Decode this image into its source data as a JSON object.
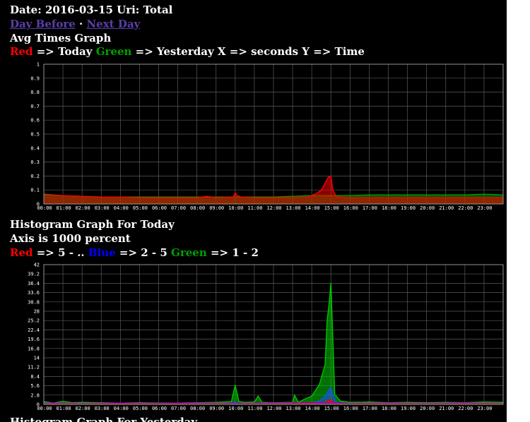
{
  "header": {
    "date_line": "Date: 2016-03-15 Uri: Total",
    "nav": {
      "prev": "Day Before",
      "sep": " · ",
      "next": "Next Day"
    }
  },
  "avg_section": {
    "title": "Avg Times Graph",
    "legend": [
      {
        "text": "Red",
        "color": "#ff0000"
      },
      {
        "text": " => Today ",
        "color": "#ffffff"
      },
      {
        "text": "Green",
        "color": "#00a000"
      },
      {
        "text": " => Yesterday X => seconds Y => Time",
        "color": "#ffffff"
      }
    ]
  },
  "hist_section": {
    "title": "Histogram Graph For Today",
    "subtitle": "Axis is 1000 percent",
    "legend": [
      {
        "text": "Red",
        "color": "#ff0000"
      },
      {
        "text": " => 5 - .. ",
        "color": "#ffffff"
      },
      {
        "text": "Blue",
        "color": "#0000ff"
      },
      {
        "text": " => 2 - 5 ",
        "color": "#ffffff"
      },
      {
        "text": "Green",
        "color": "#00a000"
      },
      {
        "text": " => 1 - 2",
        "color": "#ffffff"
      }
    ]
  },
  "footer": {
    "partial_title": "Histogram Graph For Yesterday"
  },
  "chart_data": [
    {
      "type": "area",
      "x_unit": "hour",
      "xlim": [
        0,
        24
      ],
      "ylim": [
        0,
        1
      ],
      "yticks": [
        "0",
        "0.1",
        "0.2",
        "0.3",
        "0.4",
        "0.5",
        "0.6",
        "0.7",
        "0.8",
        "0.9",
        "1"
      ],
      "xticks": [
        "00:00",
        "01:00",
        "02:00",
        "03:00",
        "04:00",
        "05:00",
        "06:00",
        "07:00",
        "08:00",
        "09:00",
        "10:00",
        "11:00",
        "12:00",
        "13:00",
        "14:00",
        "15:00",
        "16:00",
        "17:00",
        "18:00",
        "19:00",
        "20:00",
        "21:00",
        "22:00",
        "23:00"
      ],
      "grid": true,
      "series": [
        {
          "color": "#00a000",
          "fill": true,
          "x": [
            0,
            1,
            2,
            3,
            4,
            5,
            6,
            7,
            8,
            9,
            10,
            11,
            12,
            13,
            14,
            15,
            16,
            17,
            18,
            19,
            20,
            21,
            22,
            23,
            24
          ],
          "y": [
            0.07,
            0.06,
            0.055,
            0.05,
            0.05,
            0.05,
            0.05,
            0.05,
            0.05,
            0.05,
            0.05,
            0.05,
            0.05,
            0.055,
            0.06,
            0.06,
            0.06,
            0.065,
            0.065,
            0.065,
            0.065,
            0.065,
            0.065,
            0.07,
            0.065
          ]
        },
        {
          "color": "#ff0000",
          "fill": true,
          "x": [
            0,
            1,
            2,
            3,
            4,
            5,
            6,
            7,
            8,
            8.5,
            9,
            9.9,
            10,
            10.1,
            10.3,
            11,
            12,
            13,
            13.8,
            14,
            14.3,
            14.5,
            14.7,
            14.85,
            15,
            15.1,
            15.3,
            16,
            17,
            18,
            19,
            20,
            21,
            22,
            23,
            24
          ],
          "y": [
            0.065,
            0.06,
            0.055,
            0.05,
            0.05,
            0.045,
            0.045,
            0.045,
            0.045,
            0.055,
            0.045,
            0.05,
            0.08,
            0.06,
            0.05,
            0.045,
            0.045,
            0.045,
            0.05,
            0.06,
            0.08,
            0.1,
            0.15,
            0.19,
            0.2,
            0.1,
            0.05,
            0.045,
            0.045,
            0.045,
            0.045,
            0.045,
            0.045,
            0.045,
            0.045,
            0.045
          ]
        }
      ]
    },
    {
      "type": "area",
      "x_unit": "hour",
      "xlim": [
        0,
        24
      ],
      "ylim": [
        0,
        42
      ],
      "yticks": [
        "0",
        "2.8",
        "5.6",
        "8.4",
        "11.2",
        "14",
        "16.8",
        "19.6",
        "22.4",
        "25.2",
        "28",
        "30.8",
        "33.6",
        "36.4",
        "39.2",
        "42"
      ],
      "xticks": [
        "00:00",
        "01:00",
        "02:00",
        "03:00",
        "04:00",
        "05:00",
        "06:00",
        "07:00",
        "08:00",
        "09:00",
        "10:00",
        "11:00",
        "12:00",
        "13:00",
        "14:00",
        "15:00",
        "16:00",
        "17:00",
        "18:00",
        "19:00",
        "20:00",
        "21:00",
        "22:00",
        "23:00"
      ],
      "grid": true,
      "series": [
        {
          "name": "Green",
          "color": "#00cc00",
          "fill": true,
          "x": [
            0,
            0.5,
            1,
            1.5,
            2,
            3,
            4,
            5,
            6,
            7,
            8,
            9,
            9.8,
            10,
            10.2,
            10.5,
            11,
            11.2,
            11.4,
            12,
            13,
            13.1,
            13.3,
            13.6,
            14,
            14.4,
            14.7,
            14.8,
            14.9,
            15.0,
            15.1,
            15.2,
            15.5,
            16,
            17,
            18,
            19,
            20,
            21,
            22,
            23,
            24
          ],
          "y": [
            0.8,
            0.4,
            0.9,
            0.5,
            0.6,
            0.5,
            0.4,
            0.5,
            0.4,
            0.4,
            0.5,
            0.6,
            0.8,
            5.8,
            0.8,
            0.6,
            0.7,
            2.5,
            0.6,
            0.5,
            0.6,
            2.8,
            0.6,
            1.5,
            2.5,
            6,
            12,
            25,
            30,
            36.5,
            20,
            3,
            1,
            0.6,
            0.7,
            0.5,
            0.6,
            0.5,
            0.6,
            0.5,
            0.7,
            0.6
          ]
        },
        {
          "name": "Blue",
          "color": "#1a4fff",
          "fill": true,
          "x": [
            0,
            4,
            8,
            9.8,
            10,
            10.2,
            12,
            13,
            14,
            14.4,
            14.7,
            14.9,
            15.0,
            15.1,
            15.3,
            16,
            20,
            24
          ],
          "y": [
            0.2,
            0.2,
            0.2,
            0.2,
            0.8,
            0.2,
            0.2,
            0.3,
            0.5,
            1,
            2.5,
            4.5,
            5,
            3,
            0.5,
            0.2,
            0.2,
            0.2
          ]
        },
        {
          "name": "Red",
          "color": "#ff0000",
          "fill": true,
          "x": [
            0,
            4,
            8,
            10,
            12,
            14,
            14.7,
            14.9,
            15.0,
            15.1,
            15.3,
            16,
            20,
            24
          ],
          "y": [
            0.1,
            0.1,
            0.1,
            0.2,
            0.1,
            0.2,
            0.6,
            1.2,
            1.5,
            0.8,
            0.2,
            0.1,
            0.1,
            0.1
          ]
        },
        {
          "name": "Purple",
          "color": "#a000c0",
          "fill": false,
          "x": [
            0,
            2,
            4,
            6,
            8,
            10,
            12,
            14,
            16,
            18,
            20,
            22,
            24
          ],
          "y": [
            0.4,
            0.3,
            0.4,
            0.3,
            0.4,
            0.3,
            0.4,
            0.5,
            0.3,
            0.4,
            0.3,
            0.4,
            0.3
          ]
        }
      ]
    }
  ]
}
